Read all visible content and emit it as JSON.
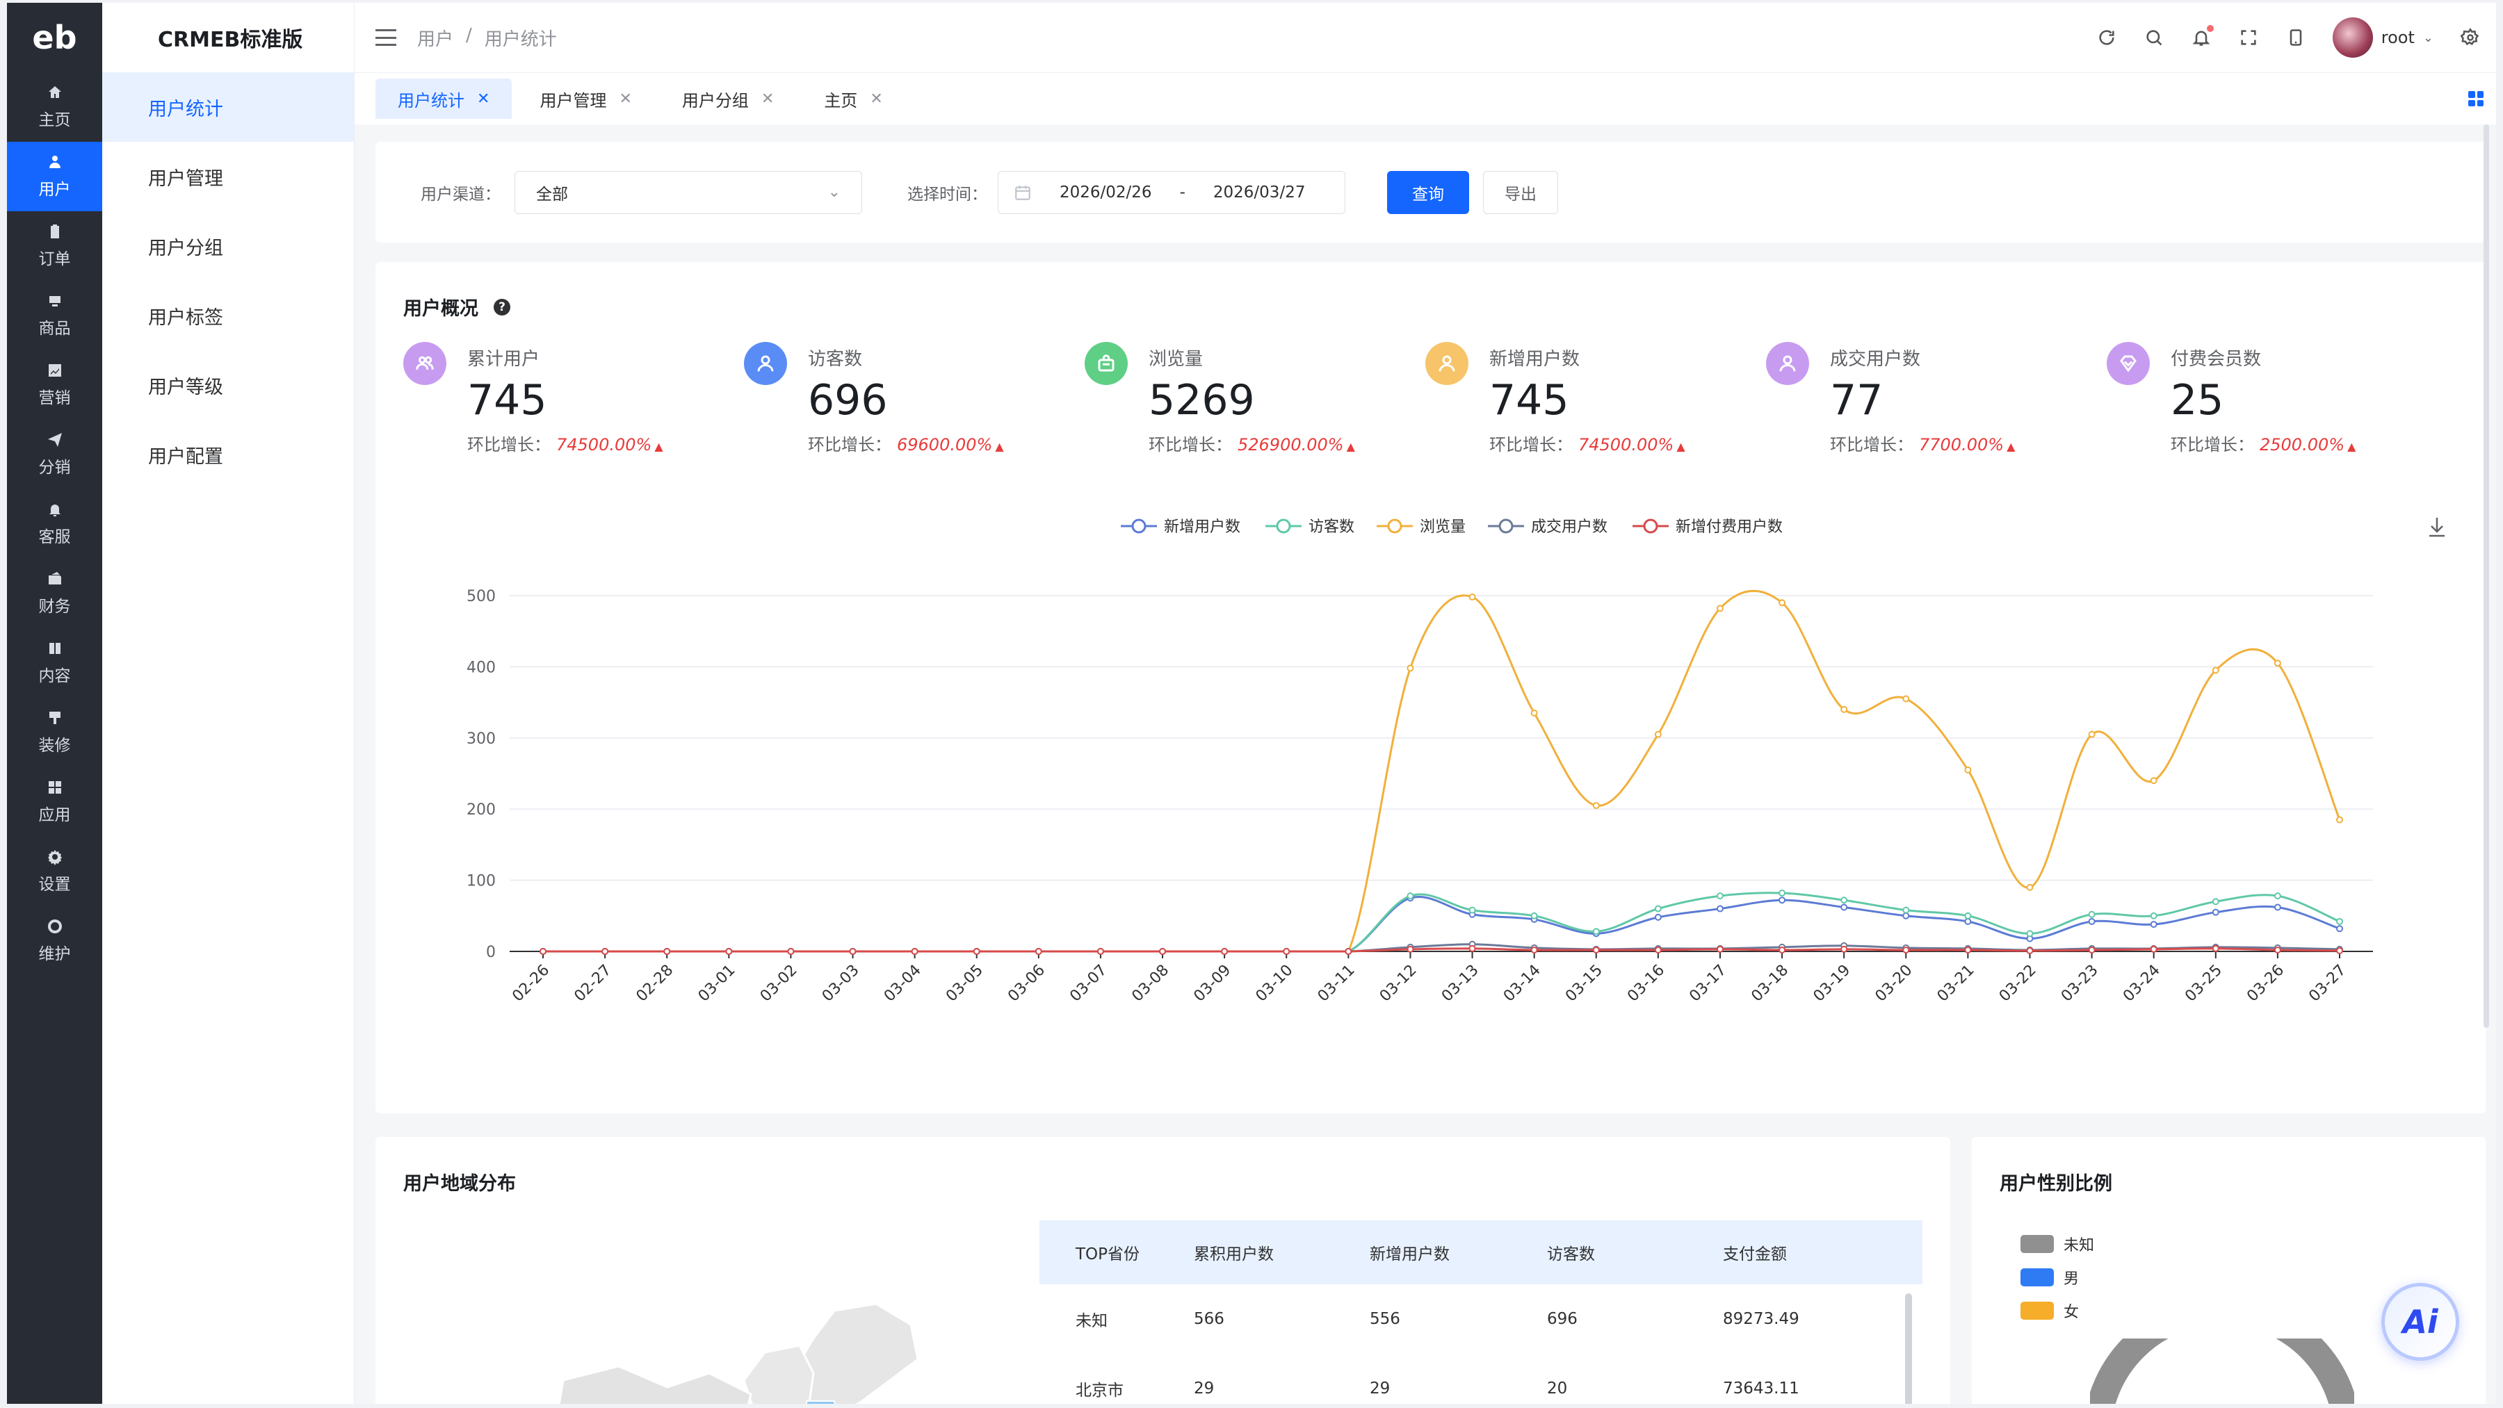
{
  "rail": {
    "logo": "eb",
    "items": [
      {
        "label": "主页",
        "icon": "home-icon"
      },
      {
        "label": "用户",
        "icon": "user-icon"
      },
      {
        "label": "订单",
        "icon": "clipboard-icon"
      },
      {
        "label": "商品",
        "icon": "box-icon"
      },
      {
        "label": "营销",
        "icon": "chart-icon"
      },
      {
        "label": "分销",
        "icon": "send-icon"
      },
      {
        "label": "客服",
        "icon": "bell-icon"
      },
      {
        "label": "财务",
        "icon": "wallet-icon"
      },
      {
        "label": "内容",
        "icon": "book-icon"
      },
      {
        "label": "装修",
        "icon": "brush-icon"
      },
      {
        "label": "应用",
        "icon": "apps-icon"
      },
      {
        "label": "设置",
        "icon": "gear-icon"
      },
      {
        "label": "维护",
        "icon": "settings-cog-icon"
      }
    ],
    "active_index": 1
  },
  "subnav": {
    "brand": "CRMEB标准版",
    "items": [
      "用户统计",
      "用户管理",
      "用户分组",
      "用户标签",
      "用户等级",
      "用户配置"
    ],
    "active_index": 0
  },
  "header": {
    "breadcrumb": [
      "用户",
      "/",
      "用户统计"
    ],
    "username": "root"
  },
  "tabs": [
    {
      "label": "用户统计",
      "active": true
    },
    {
      "label": "用户管理",
      "active": false
    },
    {
      "label": "用户分组",
      "active": false
    },
    {
      "label": "主页",
      "active": false
    }
  ],
  "filter": {
    "channel_label": "用户渠道：",
    "channel_value": "全部",
    "time_label": "选择时间：",
    "date_start": "2026/02/26",
    "date_sep": "-",
    "date_end": "2026/03/27",
    "query_label": "查询",
    "export_label": "导出"
  },
  "overview": {
    "title": "用户概况",
    "growth_label": "环比增长：",
    "stats": [
      {
        "label": "累计用户",
        "value": "745",
        "growth": "74500.00%",
        "color": "#c79cf0",
        "icon": "users-icon"
      },
      {
        "label": "访客数",
        "value": "696",
        "growth": "69600.00%",
        "color": "#5a8cf6",
        "icon": "user-icon"
      },
      {
        "label": "浏览量",
        "value": "5269",
        "growth": "526900.00%",
        "color": "#5fcf85",
        "icon": "bag-icon"
      },
      {
        "label": "新增用户数",
        "value": "745",
        "growth": "74500.00%",
        "color": "#f7c46a",
        "icon": "user-add-icon"
      },
      {
        "label": "成交用户数",
        "value": "77",
        "growth": "7700.00%",
        "color": "#c79cf0",
        "icon": "user-check-icon"
      },
      {
        "label": "付费会员数",
        "value": "25",
        "growth": "2500.00%",
        "color": "#c79cf0",
        "icon": "vip-icon"
      }
    ]
  },
  "chart_data": {
    "type": "line",
    "title": "",
    "xlabel": "",
    "ylabel": "",
    "ylim": [
      0,
      500
    ],
    "yticks": [
      0,
      100,
      200,
      300,
      400,
      500
    ],
    "legend_position": "top-center",
    "grid": true,
    "x": [
      "02-26",
      "02-27",
      "02-28",
      "03-01",
      "03-02",
      "03-03",
      "03-04",
      "03-05",
      "03-06",
      "03-07",
      "03-08",
      "03-09",
      "03-10",
      "03-11",
      "03-12",
      "03-13",
      "03-14",
      "03-15",
      "03-16",
      "03-17",
      "03-18",
      "03-19",
      "03-20",
      "03-21",
      "03-22",
      "03-23",
      "03-24",
      "03-25",
      "03-26",
      "03-27"
    ],
    "series": [
      {
        "name": "新增用户数",
        "color": "#5b7bd5",
        "values": [
          0,
          0,
          0,
          0,
          0,
          0,
          0,
          0,
          0,
          0,
          0,
          0,
          0,
          0,
          75,
          52,
          45,
          25,
          48,
          60,
          72,
          62,
          50,
          42,
          18,
          42,
          38,
          55,
          62,
          32
        ]
      },
      {
        "name": "访客数",
        "color": "#5fc8a8",
        "values": [
          0,
          0,
          0,
          0,
          0,
          0,
          0,
          0,
          0,
          0,
          0,
          0,
          0,
          0,
          78,
          58,
          50,
          28,
          60,
          78,
          82,
          72,
          58,
          50,
          25,
          52,
          50,
          70,
          78,
          42
        ]
      },
      {
        "name": "浏览量",
        "color": "#f1b03b",
        "values": [
          0,
          0,
          0,
          0,
          0,
          0,
          0,
          0,
          0,
          0,
          0,
          0,
          0,
          0,
          398,
          498,
          335,
          205,
          305,
          482,
          490,
          340,
          355,
          255,
          90,
          305,
          240,
          395,
          405,
          185
        ]
      },
      {
        "name": "成交用户数",
        "color": "#6c7a99",
        "values": [
          0,
          0,
          0,
          0,
          0,
          0,
          0,
          0,
          0,
          0,
          0,
          0,
          0,
          0,
          6,
          10,
          5,
          3,
          4,
          4,
          6,
          8,
          5,
          4,
          2,
          4,
          4,
          6,
          5,
          3
        ]
      },
      {
        "name": "新增付费用户数",
        "color": "#d74a4a",
        "values": [
          0,
          0,
          0,
          0,
          0,
          0,
          0,
          0,
          0,
          0,
          0,
          0,
          0,
          0,
          3,
          4,
          2,
          2,
          2,
          3,
          2,
          3,
          2,
          2,
          1,
          2,
          3,
          4,
          2,
          1
        ]
      }
    ]
  },
  "region": {
    "title": "用户地域分布",
    "columns": [
      "TOP省份",
      "累积用户数",
      "新增用户数",
      "访客数",
      "支付金额"
    ],
    "rows": [
      [
        "未知",
        "566",
        "556",
        "696",
        "89273.49"
      ],
      [
        "北京市",
        "29",
        "29",
        "20",
        "73643.11"
      ]
    ]
  },
  "gender": {
    "title": "用户性别比例",
    "legend": [
      {
        "label": "未知",
        "color": "#909090"
      },
      {
        "label": "男",
        "color": "#2f7bf3"
      },
      {
        "label": "女",
        "color": "#f5ad2a"
      }
    ]
  },
  "ai": {
    "label": "Ai"
  }
}
